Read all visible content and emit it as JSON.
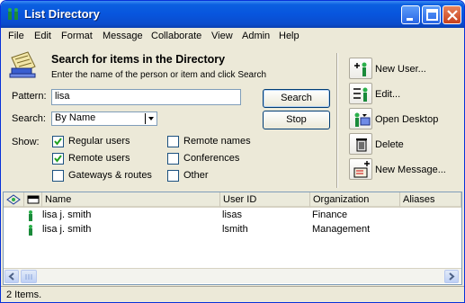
{
  "window": {
    "title": "List Directory"
  },
  "menu": [
    "File",
    "Edit",
    "Format",
    "Message",
    "Collaborate",
    "View",
    "Admin",
    "Help"
  ],
  "search": {
    "heading": "Search for items in the Directory",
    "subheading": "Enter the name of the person or item and click Search",
    "pattern_label": "Pattern:",
    "pattern_value": "lisa",
    "search_label": "Search:",
    "search_by": "By Name",
    "show_label": "Show:",
    "search_button": "Search",
    "stop_button": "Stop",
    "options": [
      {
        "label": "Regular users",
        "checked": true
      },
      {
        "label": "Remote users",
        "checked": true
      },
      {
        "label": "Gateways & routes",
        "checked": false
      },
      {
        "label": "Remote names",
        "checked": false
      },
      {
        "label": "Conferences",
        "checked": false
      },
      {
        "label": "Other",
        "checked": false
      }
    ]
  },
  "actions": [
    "New User...",
    "Edit...",
    "Open Desktop",
    "Delete",
    "New Message..."
  ],
  "list": {
    "columns": [
      "Name",
      "User ID",
      "Organization",
      "Aliases"
    ],
    "rows": [
      {
        "name": "lisa j. smith",
        "user_id": "lisas",
        "organization": "Finance"
      },
      {
        "name": "lisa j. smith",
        "user_id": "lsmith",
        "organization": "Management"
      }
    ]
  },
  "status": "2 Items.",
  "colors": {
    "title_bar": "#0855dd",
    "face": "#ece9d8",
    "person_icon": "#1a8a3a"
  }
}
